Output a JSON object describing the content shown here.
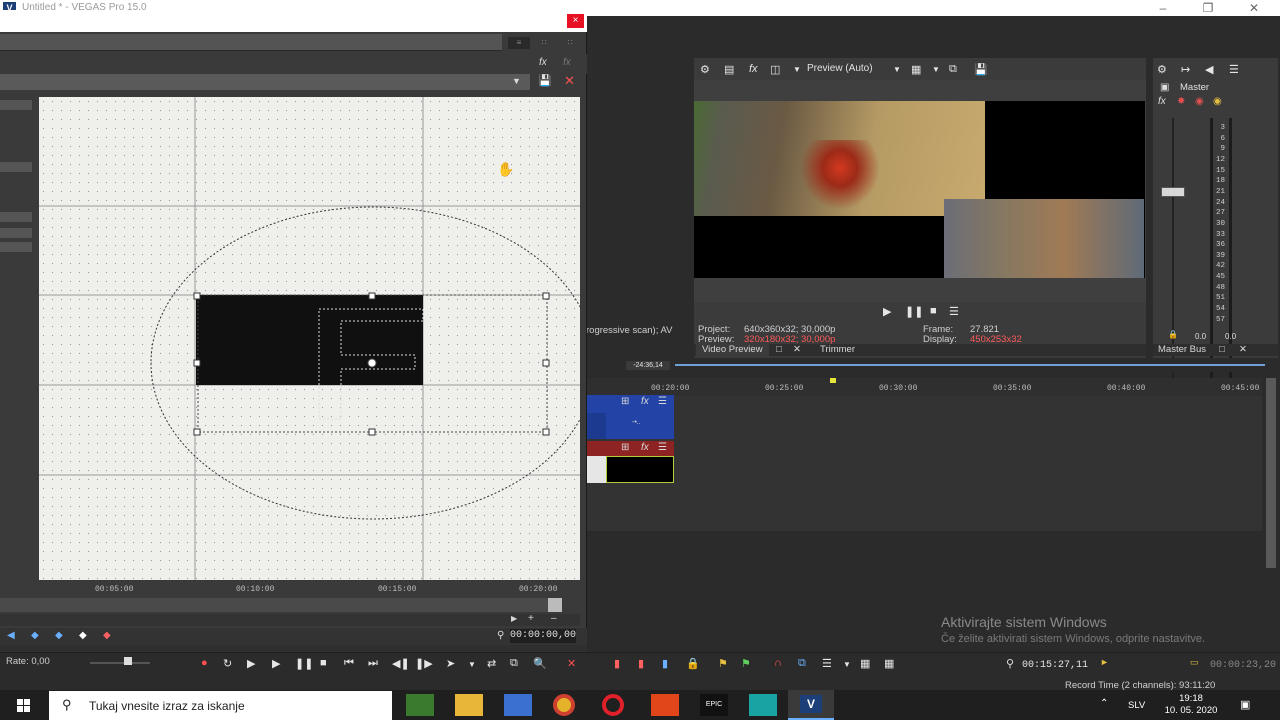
{
  "window": {
    "title": "Untitled * - VEGAS Pro 15.0",
    "app_icon": "V"
  },
  "dialog": {
    "close_label": "×",
    "ruler_ticks": [
      "00:05:00",
      "00:10:00",
      "00:15:00",
      "00:20:00"
    ],
    "time": "00:00:00,00"
  },
  "preview": {
    "mode_label": "Preview (Auto)",
    "project_label": "Project:",
    "project_value": "640x360x32; 30,000p",
    "preview_label": "Preview:",
    "preview_value": "320x180x32; 30,000p",
    "frame_label": "Frame:",
    "frame_value": "27.821",
    "display_label": "Display:",
    "display_value": "450x253x32",
    "tab_video": "Video Preview",
    "tab_trimmer": "Trimmer",
    "scan_text": "rogressive scan); AV"
  },
  "master": {
    "name": "Master",
    "tab": "Master Bus",
    "db_scale": [
      "3",
      "6",
      "9",
      "12",
      "15",
      "18",
      "21",
      "24",
      "27",
      "30",
      "33",
      "36",
      "39",
      "42",
      "45",
      "48",
      "51",
      "54",
      "57"
    ],
    "left_level": "0.0",
    "right_level": "0.0"
  },
  "timeline": {
    "cursor_marker": "-24:36,14",
    "ruler_ticks": [
      "00:20:00",
      "00:25:00",
      "00:30:00",
      "00:35:00",
      "00:40:00",
      "00:45:00"
    ],
    "current_time": "00:15:27,11",
    "selection_time": "00:00:23,20",
    "record_time": "Record Time (2 channels): 93:11:20"
  },
  "transport": {
    "rate": "Rate: 0,00"
  },
  "watermark": {
    "title": "Aktivirajte sistem Windows",
    "subtitle": "Če želite aktivirati sistem Windows, odprite nastavitve."
  },
  "taskbar": {
    "search_placeholder": "Tukaj vnesite izraz za iskanje",
    "language": "SLV",
    "time": "19:18",
    "date": "10. 05. 2020"
  },
  "colors": {
    "accent": "#2344a6",
    "video_track": "#8e2323",
    "close": "#e81123",
    "info_value": "#ff5a5a"
  }
}
